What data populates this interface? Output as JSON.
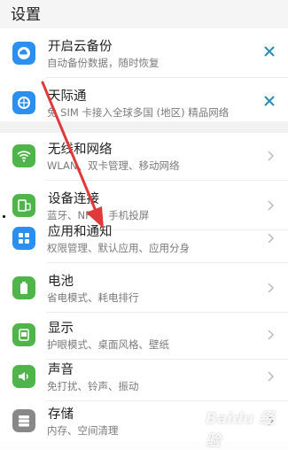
{
  "header": {
    "title": "设置"
  },
  "cloud_section": [
    {
      "name": "开启云备份",
      "sub": "自动备份数据，随时恢复",
      "icon": "cloud-backup-icon",
      "color": "#2b8ff0"
    },
    {
      "name": "天际通",
      "sub": "免 SIM 卡接入全球多国 (地区) 精品网络",
      "icon": "skytone-icon",
      "color": "#2b8ff0"
    }
  ],
  "settings": [
    {
      "name": "无线和网络",
      "sub": "WLAN、双卡管理、移动网络",
      "icon": "wifi-icon",
      "color": "#4fb54a"
    },
    {
      "name": "设备连接",
      "sub": "蓝牙、NFC、手机投屏",
      "icon": "device-connection-icon",
      "color": "#4fb54a"
    },
    {
      "name": "应用和通知",
      "sub": "权限管理、默认应用、应用分身",
      "icon": "apps-icon",
      "color": "#2b8ff0"
    },
    {
      "name": "电池",
      "sub": "省电模式、耗电排行",
      "icon": "battery-icon",
      "color": "#4fb54a"
    },
    {
      "name": "显示",
      "sub": "护眼模式、桌面风格、壁纸",
      "icon": "display-icon",
      "color": "#4fb54a"
    },
    {
      "name": "声音",
      "sub": "免打扰、铃声、振动",
      "icon": "sound-icon",
      "color": "#4fb54a"
    },
    {
      "name": "存储",
      "sub": "内存、空间清理",
      "icon": "storage-icon",
      "color": "#888888"
    }
  ],
  "watermark": "Baidu 经验"
}
